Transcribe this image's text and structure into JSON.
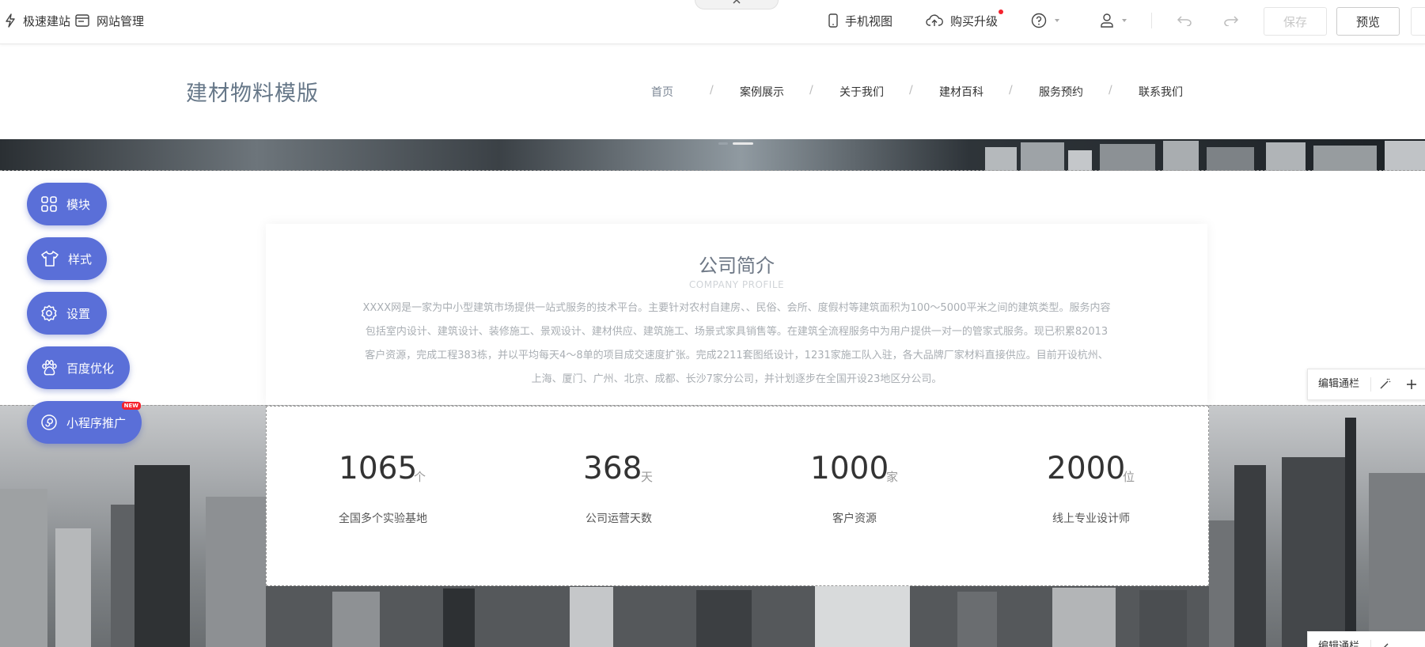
{
  "toolbar": {
    "quick_build": "极速建站",
    "site_manage": "网站管理",
    "mobile_view": "手机视图",
    "buy_upgrade": "购买升级",
    "save": "保存",
    "preview": "预览"
  },
  "site": {
    "logo": "建材物料模版",
    "nav": [
      "首页",
      "案例展示",
      "关于我们",
      "建材百科",
      "服务预约",
      "联系我们"
    ],
    "nav_separator": "/"
  },
  "profile": {
    "title": "公司简介",
    "subtitle": "COMPANY PROFILE",
    "text": "XXXX网是一家为中小型建筑市场提供一站式服务的技术平台。主要针对农村自建房、、民俗、会所、度假村等建筑面积为100～5000平米之间的建筑类型。服务内容包括室内设计、建筑设计、装修施工、景观设计、建材供应、建筑施工、场景式家具销售等。在建筑全流程服务中为用户提供一对一的管家式服务。现已积累82013客户资源，完成工程383栋，并以平均每天4～8单的项目成交速度扩张。完成2211套图纸设计，1231家施工队入驻，各大品牌厂家材料直接供应。目前开设杭州、上海、厦门、广州、北京、成都、长沙7家分公司，并计划逐步在全国开设23地区分公司。"
  },
  "stats": [
    {
      "value": "1065",
      "unit": "个",
      "label": "全国多个实验基地"
    },
    {
      "value": "368",
      "unit": "天",
      "label": "公司运营天数"
    },
    {
      "value": "1000",
      "unit": "家",
      "label": "客户资源"
    },
    {
      "value": "2000",
      "unit": "位",
      "label": "线上专业设计师"
    }
  ],
  "float_menu": {
    "module": "模块",
    "style": "样式",
    "settings": "设置",
    "baidu_seo": "百度优化",
    "mini_program": "小程序推广",
    "new_badge": "NEW"
  },
  "edit_bar": {
    "label": "编辑通栏"
  },
  "colors": {
    "accent": "#5a6fd8",
    "badge": "#f5222d",
    "logo": "#667788"
  }
}
